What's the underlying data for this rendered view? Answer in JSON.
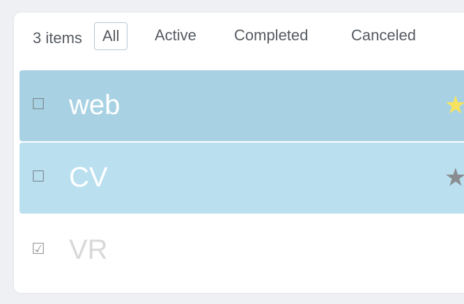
{
  "filter_bar": {
    "count_text": "3 items",
    "tabs": [
      {
        "label": "All",
        "selected": true
      },
      {
        "label": "Active",
        "selected": false
      },
      {
        "label": "Completed",
        "selected": false
      },
      {
        "label": "Canceled",
        "selected": false
      }
    ]
  },
  "items": [
    {
      "checkbox": "☐",
      "label": "web",
      "star": "★",
      "star_color": "#f7e25f",
      "background": "#a8d2e3"
    },
    {
      "checkbox": "☐",
      "label": "CV",
      "star": "★",
      "star_color": "#8a8d90",
      "background": "#bae0f0"
    },
    {
      "checkbox": "☑",
      "label": "VR",
      "star": "",
      "star_color": "",
      "background": "#ffffff"
    }
  ],
  "colors": {
    "page_background": "#eef0f4",
    "card_background": "#ffffff",
    "tab_border": "#b9c6d2",
    "text": "#555a60"
  }
}
